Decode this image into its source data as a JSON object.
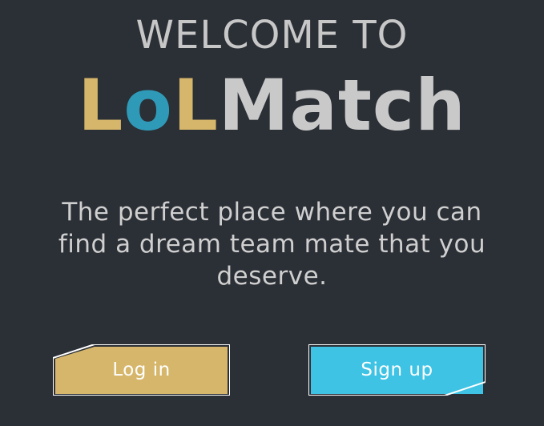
{
  "header": {
    "welcome": "WELCOME TO",
    "brand": {
      "part1": "L",
      "part2": "o",
      "part3": "L",
      "part4": "Match"
    }
  },
  "tagline": "The perfect place where you can find a dream team mate that you deserve.",
  "buttons": {
    "login_label": "Log in",
    "signup_label": "Sign up"
  },
  "colors": {
    "background": "#2b2f36",
    "gold": "#d6b66a",
    "teal": "#2f9ab8",
    "signup": "#3ec3e4",
    "text_light": "#c9c9c9"
  }
}
